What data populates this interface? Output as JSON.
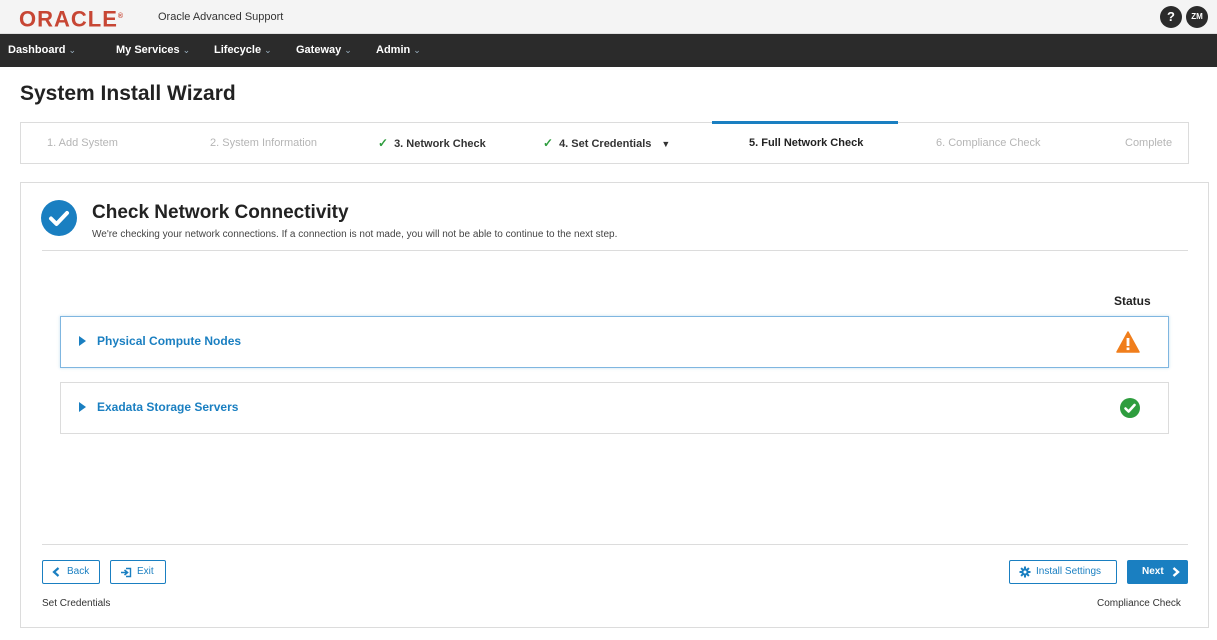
{
  "header": {
    "logo": "ORACLE",
    "product": "Oracle Advanced Support",
    "help_label": "?",
    "user_initials": "ZM"
  },
  "nav": {
    "items": [
      {
        "label": "Dashboard"
      },
      {
        "label": "My Services"
      },
      {
        "label": "Lifecycle"
      },
      {
        "label": "Gateway"
      },
      {
        "label": "Admin"
      }
    ]
  },
  "page": {
    "title": "System Install Wizard"
  },
  "steps": [
    {
      "label": "1. Add System",
      "state": "disabled"
    },
    {
      "label": "2. System Information",
      "state": "disabled"
    },
    {
      "label": "3. Network Check",
      "state": "done"
    },
    {
      "label": "4. Set Credentials",
      "state": "done",
      "has_menu": true
    },
    {
      "label": "5. Full Network Check",
      "state": "current"
    },
    {
      "label": "6. Compliance Check",
      "state": "disabled"
    },
    {
      "label": "Complete",
      "state": "disabled"
    }
  ],
  "section": {
    "title": "Check Network Connectivity",
    "description": "We're checking your network connections. If a connection is not made, you will not be able to continue to the next step.",
    "status_header": "Status"
  },
  "groups": [
    {
      "label": "Physical Compute Nodes",
      "status": "warning",
      "status_color": "#f07e1c"
    },
    {
      "label": "Exadata Storage Servers",
      "status": "ok",
      "status_color": "#2e9d3e"
    }
  ],
  "footer": {
    "back_label": "Back",
    "exit_label": "Exit",
    "settings_label": "Install Settings",
    "next_label": "Next",
    "prev_step": "Set Credentials",
    "next_step": "Compliance Check"
  },
  "colors": {
    "accent": "#1a7fc1",
    "brand": "#c74634",
    "nav_bg": "#2b2b2b",
    "success": "#2e9d3e",
    "warning": "#f07e1c"
  }
}
